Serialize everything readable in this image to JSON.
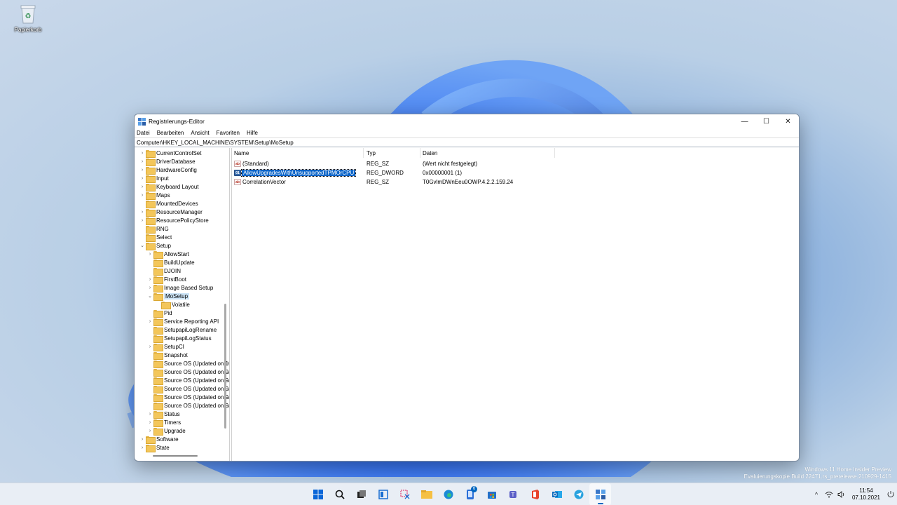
{
  "desktop": {
    "recycle_bin_label": "Papierkorb"
  },
  "window": {
    "title": "Registrierungs-Editor",
    "controls": {
      "minimize": "—",
      "maximize": "☐",
      "close": "✕"
    },
    "menu": [
      "Datei",
      "Bearbeiten",
      "Ansicht",
      "Favoriten",
      "Hilfe"
    ],
    "address": "Computer\\HKEY_LOCAL_MACHINE\\SYSTEM\\Setup\\MoSetup"
  },
  "tree": [
    {
      "label": "CurrentControlSet",
      "level": 0,
      "expander": "›"
    },
    {
      "label": "DriverDatabase",
      "level": 0,
      "expander": "›"
    },
    {
      "label": "HardwareConfig",
      "level": 0,
      "expander": "›"
    },
    {
      "label": "Input",
      "level": 0,
      "expander": "›"
    },
    {
      "label": "Keyboard Layout",
      "level": 0,
      "expander": "›"
    },
    {
      "label": "Maps",
      "level": 0,
      "expander": "›"
    },
    {
      "label": "MountedDevices",
      "level": 0,
      "expander": ""
    },
    {
      "label": "ResourceManager",
      "level": 0,
      "expander": "›"
    },
    {
      "label": "ResourcePolicyStore",
      "level": 0,
      "expander": "›"
    },
    {
      "label": "RNG",
      "level": 0,
      "expander": ""
    },
    {
      "label": "Select",
      "level": 0,
      "expander": ""
    },
    {
      "label": "Setup",
      "level": 0,
      "expander": "⌄"
    },
    {
      "label": "AllowStart",
      "level": 1,
      "expander": "›"
    },
    {
      "label": "BuildUpdate",
      "level": 1,
      "expander": ""
    },
    {
      "label": "DJOIN",
      "level": 1,
      "expander": ""
    },
    {
      "label": "FirstBoot",
      "level": 1,
      "expander": "›"
    },
    {
      "label": "Image Based Setup",
      "level": 1,
      "expander": "›"
    },
    {
      "label": "MoSetup",
      "level": 1,
      "expander": "⌄",
      "selected": true
    },
    {
      "label": "Volatile",
      "level": 2,
      "expander": ""
    },
    {
      "label": "Pid",
      "level": 1,
      "expander": ""
    },
    {
      "label": "Service Reporting API",
      "level": 1,
      "expander": "›"
    },
    {
      "label": "SetupapiLogRename",
      "level": 1,
      "expander": ""
    },
    {
      "label": "SetupapiLogStatus",
      "level": 1,
      "expander": ""
    },
    {
      "label": "SetupCI",
      "level": 1,
      "expander": "›"
    },
    {
      "label": "Snapshot",
      "level": 1,
      "expander": ""
    },
    {
      "label": "Source OS (Updated on 10",
      "level": 1,
      "expander": ""
    },
    {
      "label": "Source OS (Updated on 9/",
      "level": 1,
      "expander": ""
    },
    {
      "label": "Source OS (Updated on 9/",
      "level": 1,
      "expander": ""
    },
    {
      "label": "Source OS (Updated on 9/",
      "level": 1,
      "expander": ""
    },
    {
      "label": "Source OS (Updated on 9/",
      "level": 1,
      "expander": ""
    },
    {
      "label": "Source OS (Updated on 9/",
      "level": 1,
      "expander": ""
    },
    {
      "label": "Status",
      "level": 1,
      "expander": "›"
    },
    {
      "label": "Timers",
      "level": 1,
      "expander": "›"
    },
    {
      "label": "Upgrade",
      "level": 1,
      "expander": "›"
    },
    {
      "label": "Software",
      "level": 0,
      "expander": "›"
    },
    {
      "label": "State",
      "level": 0,
      "expander": "›"
    }
  ],
  "list": {
    "headers": {
      "name": "Name",
      "type": "Typ",
      "data": "Daten"
    },
    "rows": [
      {
        "name": "(Standard)",
        "type": "REG_SZ",
        "data": "(Wert nicht festgelegt)",
        "icon": "string-value-icon",
        "icon_text": "ab"
      },
      {
        "name": "AllowUpgradesWithUnsupportedTPMOrCPU",
        "type": "REG_DWORD",
        "data": "0x00000001 (1)",
        "icon": "binary-value-icon",
        "icon_text": "01",
        "selected": true
      },
      {
        "name": "CorrelationVector",
        "type": "REG_SZ",
        "data": "T0GvlmDWnEeu0OWP.4.2.2.159.24",
        "icon": "string-value-icon",
        "icon_text": "ab"
      }
    ]
  },
  "watermark": {
    "line1": "Windows 11 Home Insider Preview",
    "line2": "Evaluierungskopie Build 22471.rs_prerelease.210929-1415"
  },
  "taskbar": {
    "icons": [
      {
        "name": "start-icon",
        "active": false
      },
      {
        "name": "search-icon",
        "active": false
      },
      {
        "name": "task-view-icon",
        "active": false
      },
      {
        "name": "widgets-icon",
        "active": false
      },
      {
        "name": "snipping-tool-icon",
        "active": false
      },
      {
        "name": "file-explorer-icon",
        "active": false
      },
      {
        "name": "edge-icon",
        "active": false
      },
      {
        "name": "phone-link-icon",
        "active": false,
        "badge": "6"
      },
      {
        "name": "store-icon",
        "active": false
      },
      {
        "name": "teams-icon",
        "active": false
      },
      {
        "name": "office-icon",
        "active": false
      },
      {
        "name": "outlook-icon",
        "active": false
      },
      {
        "name": "telegram-icon",
        "active": false
      },
      {
        "name": "regedit-icon",
        "active": true
      }
    ],
    "clock_time": "11:54",
    "clock_date": "07.10.2021"
  },
  "colors": {
    "accent": "#0067c0",
    "selection": "#0a64c8",
    "folder": "#f3c65a"
  }
}
